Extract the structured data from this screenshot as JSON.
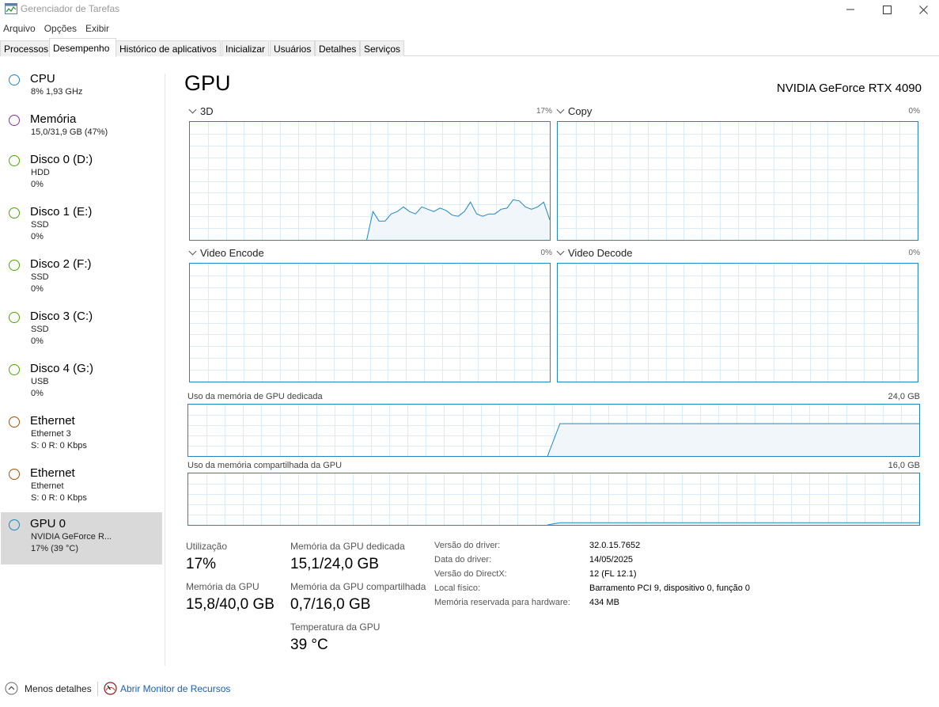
{
  "window": {
    "title": "Gerenciador de Tarefas"
  },
  "menu": [
    "Arquivo",
    "Opções",
    "Exibir"
  ],
  "tabs": [
    "Processos",
    "Desempenho",
    "Histórico de aplicativos",
    "Inicializar",
    "Usuários",
    "Detalhes",
    "Serviços"
  ],
  "active_tab": "Desempenho",
  "sidebar": [
    {
      "title": "CPU",
      "line1": "8%  1,93 GHz",
      "line2": "",
      "color": "#1f86c3",
      "icon": "cpu-circle-icon"
    },
    {
      "title": "Memória",
      "line1": "15,0/31,9 GB (47%)",
      "line2": "",
      "color": "#8b2fae",
      "icon": "memory-circle-icon"
    },
    {
      "title": "Disco 0 (D:)",
      "line1": "HDD",
      "line2": "0%",
      "color": "#4da600",
      "icon": "disk-circle-icon"
    },
    {
      "title": "Disco 1 (E:)",
      "line1": "SSD",
      "line2": "0%",
      "color": "#4da600",
      "icon": "disk-circle-icon"
    },
    {
      "title": "Disco 2 (F:)",
      "line1": "SSD",
      "line2": "0%",
      "color": "#4da600",
      "icon": "disk-circle-icon"
    },
    {
      "title": "Disco 3 (C:)",
      "line1": "SSD",
      "line2": "0%",
      "color": "#4da600",
      "icon": "disk-circle-icon"
    },
    {
      "title": "Disco 4 (G:)",
      "line1": "USB",
      "line2": "0%",
      "color": "#4da600",
      "icon": "disk-circle-icon"
    },
    {
      "title": "Ethernet",
      "line1": "Ethernet 3",
      "line2": "S: 0  R: 0 Kbps",
      "color": "#a74f01",
      "icon": "ethernet-circle-icon"
    },
    {
      "title": "Ethernet",
      "line1": "Ethernet",
      "line2": "S: 0  R: 0 Kbps",
      "color": "#a74f01",
      "icon": "ethernet-circle-icon"
    },
    {
      "title": "GPU 0",
      "line1": "NVIDIA GeForce R...",
      "line2": "17%  (39 °C)",
      "color": "#1f86c3",
      "icon": "gpu-circle-icon",
      "selected": true
    }
  ],
  "main": {
    "heading": "GPU",
    "model": "NVIDIA GeForce RTX 4090",
    "graphs": [
      {
        "label": "3D",
        "value": "17%"
      },
      {
        "label": "Copy",
        "value": "0%"
      },
      {
        "label": "Video Encode",
        "value": "0%"
      },
      {
        "label": "Video Decode",
        "value": "0%"
      }
    ],
    "dedicated_label": "Uso da memória de GPU dedicada",
    "dedicated_max": "24,0 GB",
    "shared_label": "Uso da memória compartilhada da GPU",
    "shared_max": "16,0 GB"
  },
  "chart_data": [
    {
      "type": "area",
      "title": "3D",
      "ylim": [
        0,
        100
      ],
      "x_points": 60,
      "values": [
        0,
        0,
        0,
        0,
        0,
        0,
        0,
        0,
        0,
        0,
        0,
        0,
        0,
        0,
        0,
        0,
        0,
        0,
        0,
        0,
        0,
        0,
        0,
        0,
        0,
        0,
        0,
        0,
        0,
        0,
        24,
        16,
        16,
        22,
        24,
        28,
        24,
        22,
        28,
        26,
        24,
        27,
        25,
        21,
        20,
        24,
        32,
        22,
        20,
        22,
        22,
        26,
        27,
        34,
        33,
        28,
        26,
        28,
        32,
        17
      ]
    },
    {
      "type": "area",
      "title": "Copy",
      "ylim": [
        0,
        100
      ],
      "x_points": 60,
      "values": []
    },
    {
      "type": "area",
      "title": "Video Encode",
      "ylim": [
        0,
        100
      ],
      "x_points": 60,
      "values": []
    },
    {
      "type": "area",
      "title": "Video Decode",
      "ylim": [
        0,
        100
      ],
      "x_points": 60,
      "values": []
    },
    {
      "type": "area",
      "title": "Uso da memória de GPU dedicada",
      "ylim": [
        0,
        24.0
      ],
      "x_points": 60,
      "values": [
        0,
        0,
        0,
        0,
        0,
        0,
        0,
        0,
        0,
        0,
        0,
        0,
        0,
        0,
        0,
        0,
        0,
        0,
        0,
        0,
        0,
        0,
        0,
        0,
        0,
        0,
        0,
        0,
        0,
        0,
        15.1,
        15.1,
        15.1,
        15.1,
        15.1,
        15.1,
        15.1,
        15.1,
        15.1,
        15.1,
        15.1,
        15.1,
        15.1,
        15.1,
        15.1,
        15.1,
        15.1,
        15.1,
        15.1,
        15.1,
        15.1,
        15.1,
        15.1,
        15.1,
        15.1,
        15.1,
        15.1,
        15.1,
        15.1,
        15.1
      ]
    },
    {
      "type": "area",
      "title": "Uso da memória compartilhada da GPU",
      "ylim": [
        0,
        16.0
      ],
      "x_points": 60,
      "values": [
        0,
        0,
        0,
        0,
        0,
        0,
        0,
        0,
        0,
        0,
        0,
        0,
        0,
        0,
        0,
        0,
        0,
        0,
        0,
        0,
        0,
        0,
        0,
        0,
        0,
        0,
        0,
        0,
        0,
        0,
        0.7,
        0.7,
        0.7,
        0.7,
        0.7,
        0.7,
        0.7,
        0.7,
        0.7,
        0.7,
        0.7,
        0.7,
        0.7,
        0.7,
        0.7,
        0.7,
        0.7,
        0.7,
        0.7,
        0.7,
        0.7,
        0.7,
        0.7,
        0.7,
        0.7,
        0.7,
        0.7,
        0.7,
        0.7,
        0.7
      ]
    }
  ],
  "stats": {
    "utilization_label": "Utilização",
    "utilization_value": "17%",
    "dedicated_label": "Memória da GPU dedicada",
    "dedicated_value": "15,1/24,0 GB",
    "gpu_mem_label": "Memória da GPU",
    "gpu_mem_value": "15,8/40,0 GB",
    "shared_label": "Memória da GPU compartilhada",
    "shared_value": "0,7/16,0 GB",
    "temp_label": "Temperatura da GPU",
    "temp_value": "39 °C"
  },
  "info": [
    {
      "label": "Versão do driver:",
      "value": "32.0.15.7652"
    },
    {
      "label": "Data do driver:",
      "value": "14/05/2025"
    },
    {
      "label": "Versão do DirectX:",
      "value": "12 (FL 12.1)"
    },
    {
      "label": "Local físico:",
      "value": "Barramento PCI 9, dispositivo 0, função 0"
    },
    {
      "label": "Memória reservada para hardware:",
      "value": "434 MB"
    }
  ],
  "footer": {
    "less_details": "Menos detalhes",
    "monitor": "Abrir Monitor de Recursos"
  },
  "colors": {
    "accent": "#1f86c3",
    "grid": "#d9ecf7",
    "fill": "#f1f6fb",
    "selected_bg": "#d9d9d9"
  }
}
